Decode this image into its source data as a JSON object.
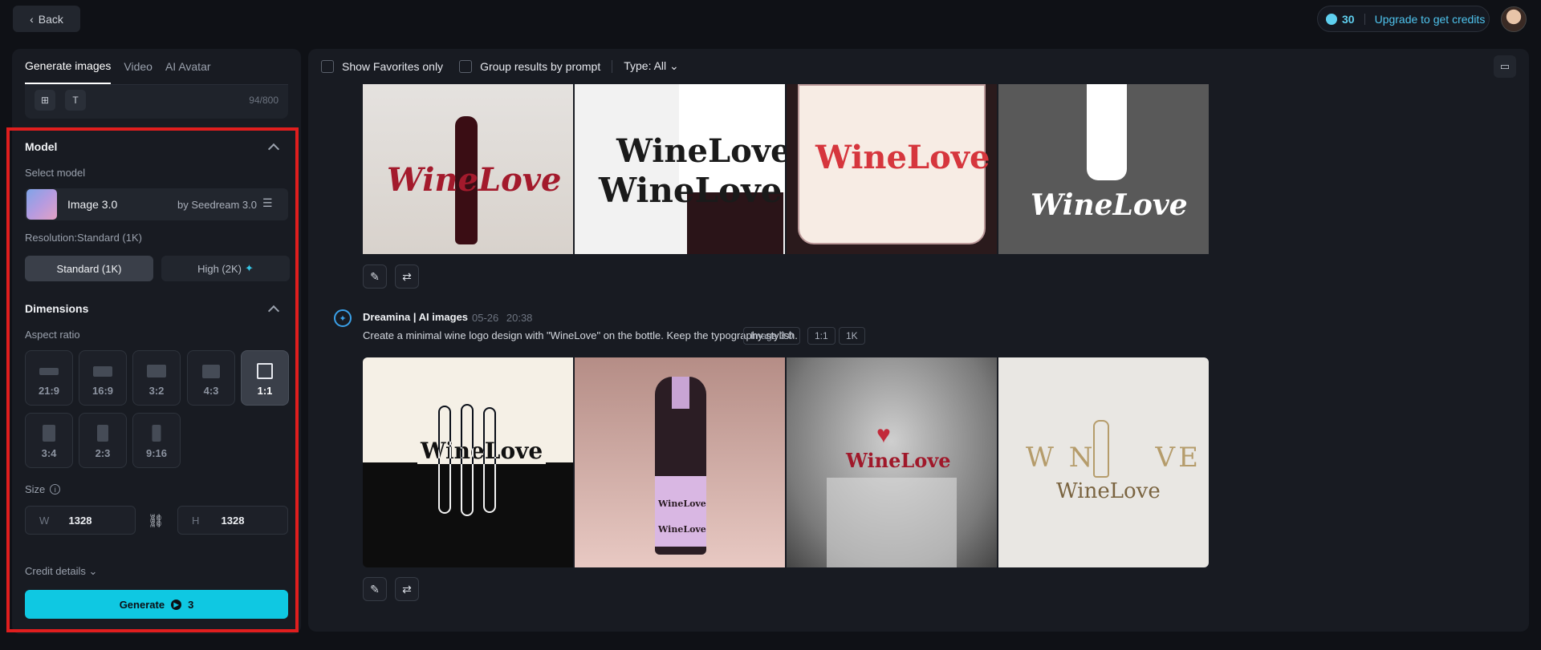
{
  "topbar": {
    "back_label": "Back",
    "credits": "30",
    "upgrade_label": "Upgrade to get credits"
  },
  "left": {
    "tabs": [
      "Generate images",
      "Video",
      "AI Avatar"
    ],
    "char_count": "94/800",
    "model_section": "Model",
    "select_model_label": "Select model",
    "model_name": "Image 3.0",
    "model_by": "by Seedream 3.0",
    "resolution_label": "Resolution:Standard (1K)",
    "res_standard": "Standard (1K)",
    "res_high": "High (2K)",
    "dimensions_section": "Dimensions",
    "aspect_label": "Aspect ratio",
    "aspect_ratios": [
      "21:9",
      "16:9",
      "3:2",
      "4:3",
      "1:1",
      "3:4",
      "2:3",
      "9:16"
    ],
    "aspect_selected": "1:1",
    "size_label": "Size",
    "width_prefix": "W",
    "width_value": "1328",
    "height_prefix": "H",
    "height_value": "1328",
    "credit_details": "Credit details",
    "generate_label": "Generate",
    "generate_cost": "3"
  },
  "right": {
    "show_favorites": "Show Favorites only",
    "group_results": "Group results by prompt",
    "type_filter": "Type: All",
    "brand_name": "Dreamina | AI images",
    "date": "05-26",
    "time": "20:38",
    "prompt": "Create a minimal wine logo design with \"WineLove\" on the bottle. Keep the typography stylish.",
    "tags": [
      "Image 3.0",
      "1:1",
      "1K"
    ],
    "logo_text": "WineLove",
    "logo_split": "W N     VE"
  }
}
